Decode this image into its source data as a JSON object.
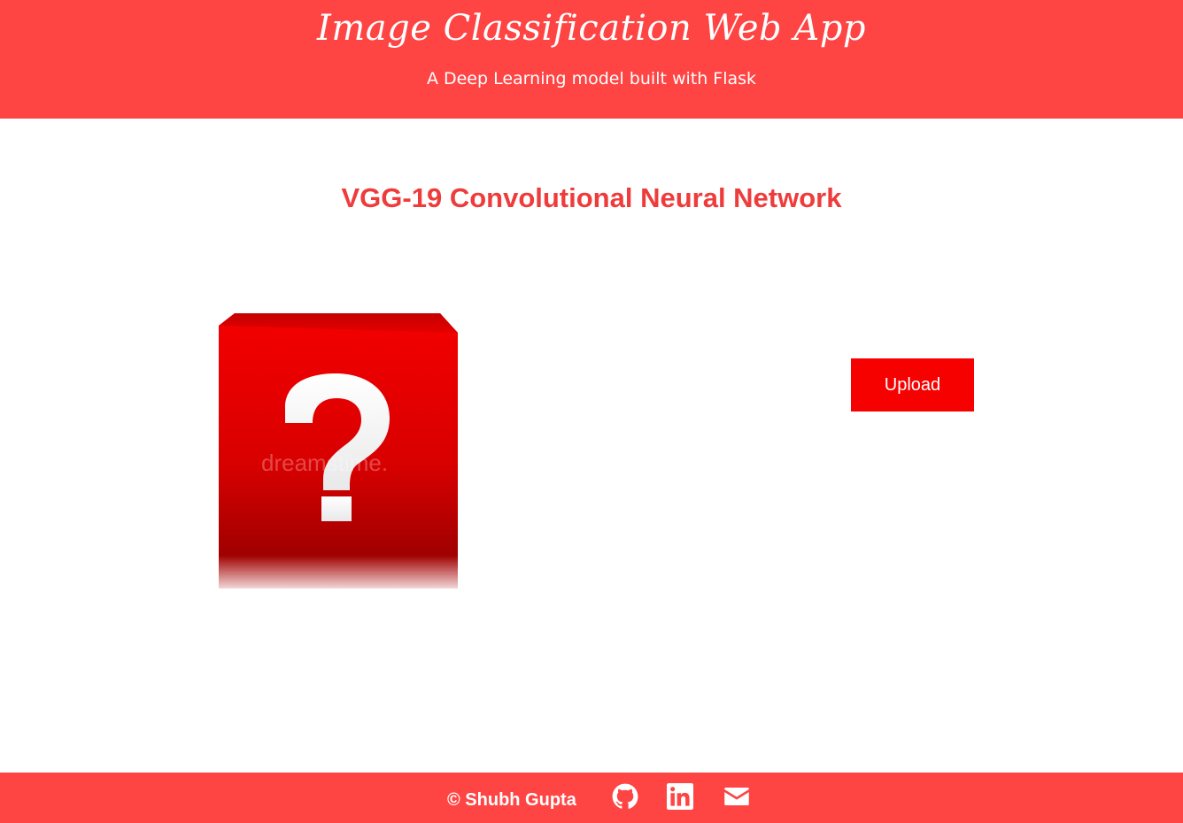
{
  "header": {
    "title": "Image Classification Web App",
    "subtitle": "A Deep Learning model built with Flask"
  },
  "main": {
    "heading": "VGG-19 Convolutional Neural Network",
    "preview_image": {
      "watermark": "dreamstime."
    },
    "upload_label": "Upload"
  },
  "footer": {
    "copyright": "© Shubh Gupta",
    "icons": [
      "github-icon",
      "linkedin-icon",
      "mail-icon"
    ]
  },
  "colors": {
    "header_bg": "#ff4444",
    "heading_red": "#ee3c3c",
    "button_red": "#f60000",
    "footer_bg": "#ff4444"
  }
}
